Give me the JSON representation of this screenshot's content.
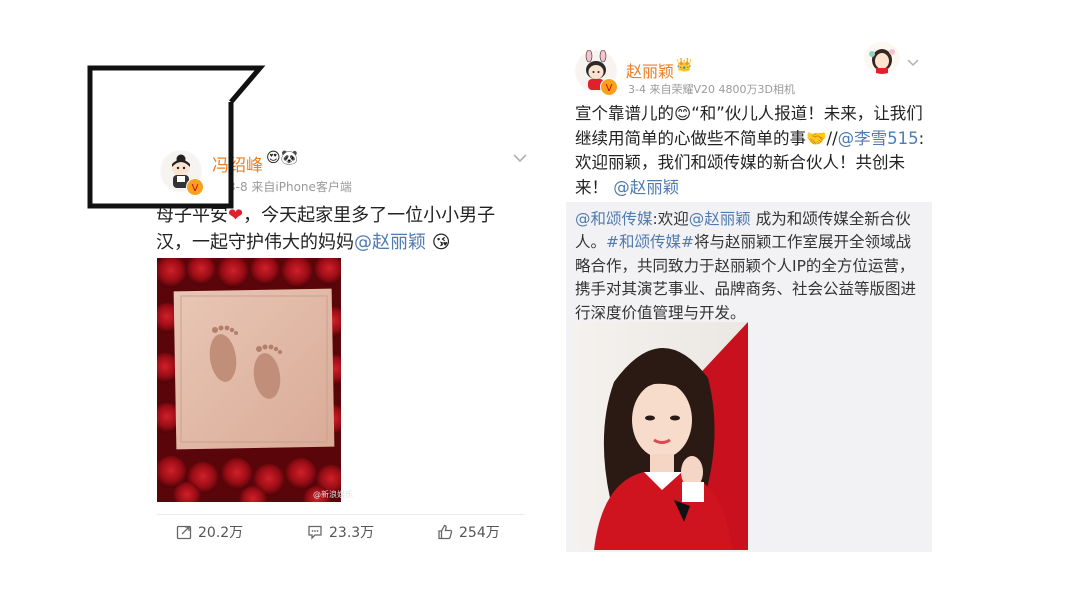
{
  "left_post": {
    "author": "冯绍峰",
    "name_emoji": "😍🐼",
    "meta": "3-8  来自iPhone客户端",
    "text_part1": "母子平安",
    "heart": "❤",
    "text_part2": "，今天起家里多了一位小小男子汉，一起守护伟大的妈妈",
    "mention": "@赵丽颖",
    "end_emoji": "😘",
    "watermark": "@新浪娱乐",
    "actions": {
      "repost_count": "20.2万",
      "comment_count": "23.3万",
      "like_count": "254万"
    },
    "icons": {
      "repost": "share-icon",
      "comment": "comment-icon",
      "like": "thumbs-up-icon",
      "chevron": "chevron-down-icon"
    }
  },
  "right_post": {
    "author": "赵丽颖",
    "name_badge": "👑",
    "meta": "3-4  来自荣耀V20 4800万3D相机",
    "text_a": "宣个靠谱儿的",
    "emoji_a": "😊",
    "text_b": "“和”伙儿人报道！未来，让我们继续用简单的心做些不简单的事",
    "emoji_b": "🤝",
    "text_c": "//",
    "mention_a": "@李雪515",
    "text_d": ":欢迎丽颖，我们和颂传媒的新合伙人！共创未来！",
    "mention_b": "@赵丽颖",
    "repost": {
      "mention_a": "@和颂传媒",
      "text_a": ":欢迎",
      "mention_b": "@赵丽颖",
      "text_b": " 成为和颂传媒全新合伙人。",
      "hashtag": "#和颂传媒#",
      "text_c": "将与赵丽颖工作室展开全领域战略合作，共同致力于赵丽颖个人IP的全方位运营，携手对其演艺事业、品牌商务、社会公益等版图进行深度价值管理与开发。"
    }
  },
  "colors": {
    "name": "#ee7e22",
    "link": "#4f7bb0",
    "meta": "#9a9a9a",
    "repost_bg": "#f2f2f5"
  }
}
